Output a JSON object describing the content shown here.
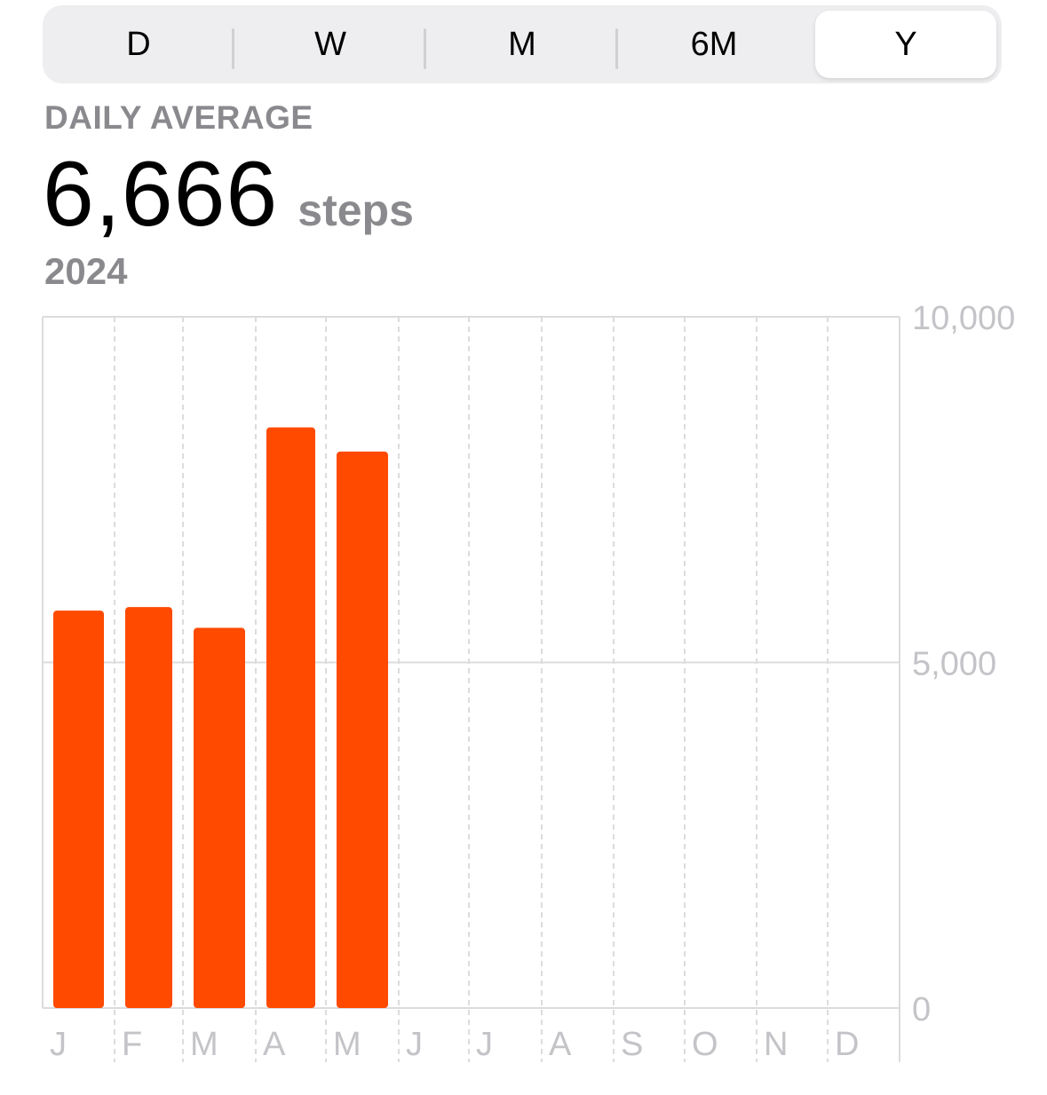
{
  "tabs": [
    {
      "label": "D",
      "selected": false
    },
    {
      "label": "W",
      "selected": false
    },
    {
      "label": "M",
      "selected": false
    },
    {
      "label": "6M",
      "selected": false
    },
    {
      "label": "Y",
      "selected": true
    }
  ],
  "summary": {
    "label": "DAILY AVERAGE",
    "value": "6,666",
    "unit": "steps",
    "period": "2024"
  },
  "colors": {
    "bar": "#ff4a00",
    "grid": "#dcdcdf",
    "tick_label": "#c4c4c8",
    "muted_text": "#8a8a8e"
  },
  "chart_data": {
    "type": "bar",
    "categories": [
      "J",
      "F",
      "M",
      "A",
      "M",
      "J",
      "J",
      "A",
      "S",
      "O",
      "N",
      "D"
    ],
    "values": [
      5750,
      5800,
      5500,
      8400,
      8050,
      null,
      null,
      null,
      null,
      null,
      null,
      null
    ],
    "y_ticks": [
      {
        "value": 10000,
        "label": "10,000"
      },
      {
        "value": 5000,
        "label": "5,000"
      },
      {
        "value": 0,
        "label": "0"
      }
    ],
    "ylim": [
      0,
      10000
    ],
    "grid": true,
    "y_axis_side": "right"
  }
}
